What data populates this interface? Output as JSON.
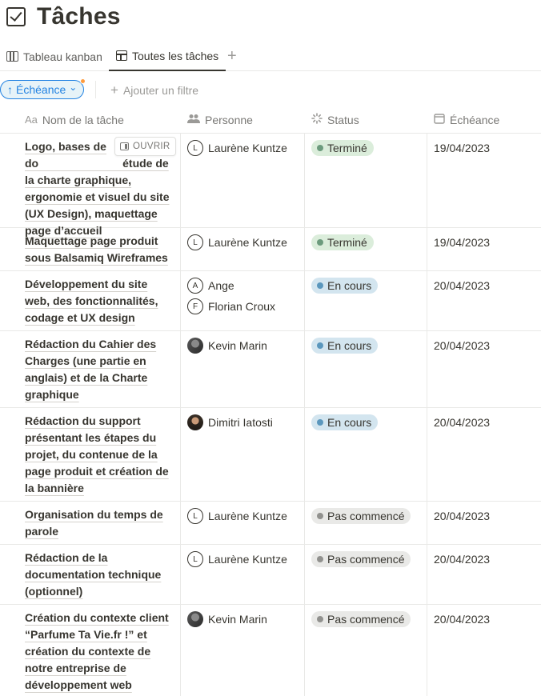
{
  "page": {
    "title": "Tâches",
    "title_icon": "checkbox-icon"
  },
  "tabs": [
    {
      "label": "Tableau kanban",
      "icon": "kanban-icon"
    },
    {
      "label": "Toutes les tâches",
      "icon": "table-icon",
      "active": true
    }
  ],
  "add_tab": "+",
  "filters": {
    "sort_label": "Échéance",
    "sort_arrow": "↑",
    "sort_chevron": "⌄",
    "add_filter": "Ajouter un filtre"
  },
  "columns": [
    {
      "label": "Nom de la tâche",
      "icon": "Aa"
    },
    {
      "label": "Personne",
      "icon": "people-icon"
    },
    {
      "label": "Status",
      "icon": "status-icon"
    },
    {
      "label": "Échéance",
      "icon": "calendar-icon"
    }
  ],
  "open_button": "OUVRIR",
  "status_colors": {
    "Terminé": {
      "bg": "#dbeddb",
      "dot": "#6c9b7d"
    },
    "En cours": {
      "bg": "#d3e5ef",
      "dot": "#5b97bd"
    },
    "Pas commencé": {
      "bg": "#e9e9e7",
      "dot": "#91918e"
    }
  },
  "rows": [
    {
      "task": "Logo, bases de do                           étude de la charte graphique, ergonomie et visuel du site (UX Design), maquettage page d’accueil",
      "people": [
        {
          "name": "Laurène Kuntze",
          "initial": "L"
        }
      ],
      "status": "Terminé",
      "date": "19/04/2023",
      "height": 118,
      "open": true
    },
    {
      "task": "Maquettage page produit sous Balsamiq Wireframes",
      "people": [
        {
          "name": "Laurène Kuntze",
          "initial": "L"
        }
      ],
      "status": "Terminé",
      "date": "19/04/2023",
      "height": 54
    },
    {
      "task": "Développement du site web, des fonctionnalités, codage et UX design",
      "people": [
        {
          "name": "Ange",
          "initial": "A"
        },
        {
          "name": "Florian Croux",
          "initial": "F"
        }
      ],
      "status": "En cours",
      "date": "20/04/2023",
      "height": 75
    },
    {
      "task": "Rédaction du Cahier des Charges (une partie en anglais) et de la Charte graphique",
      "people": [
        {
          "name": "Kevin Marin",
          "initial": "",
          "photo": "photo-kevin"
        }
      ],
      "status": "En cours",
      "date": "20/04/2023",
      "height": 96
    },
    {
      "task": "Rédaction du support présentant les étapes du projet, du contenue de la page produit et création de la bannière",
      "people": [
        {
          "name": "Dimitri Iatosti",
          "initial": "",
          "photo": "photo-dimitri"
        }
      ],
      "status": "En cours",
      "date": "20/04/2023",
      "height": 117
    },
    {
      "task": "Organisation du temps de parole",
      "people": [
        {
          "name": "Laurène Kuntze",
          "initial": "L"
        }
      ],
      "status": "Pas commencé",
      "date": "20/04/2023",
      "height": 54
    },
    {
      "task": "Rédaction de la documentation technique (optionnel)",
      "people": [
        {
          "name": "Laurène Kuntze",
          "initial": "L"
        }
      ],
      "status": "Pas commencé",
      "date": "20/04/2023",
      "height": 75
    },
    {
      "task": "Création du contexte client “Parfume Ta Vie.fr !” et création du contexte de notre entreprise de développement web",
      "people": [
        {
          "name": "Kevin Marin",
          "initial": "",
          "photo": "photo-kevin"
        }
      ],
      "status": "Pas commencé",
      "date": "20/04/2023",
      "height": 117
    }
  ]
}
